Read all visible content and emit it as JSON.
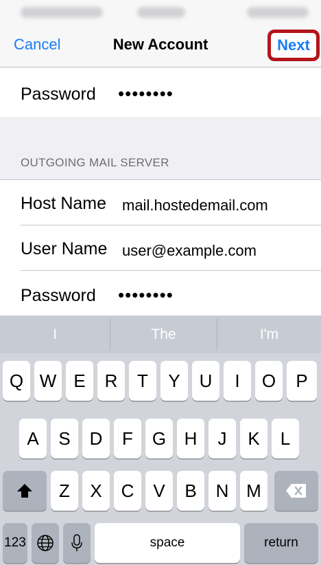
{
  "nav": {
    "cancel_label": "Cancel",
    "title": "New Account",
    "next_label": "Next"
  },
  "incoming": {
    "password_label": "Password",
    "password_value": "••••••••"
  },
  "outgoing": {
    "header": "OUTGOING MAIL SERVER",
    "host_label": "Host Name",
    "host_value": "mail.hostedemail.com",
    "user_label": "User Name",
    "user_value": "user@example.com",
    "password_label": "Password",
    "password_value": "••••••••"
  },
  "keyboard": {
    "suggestions": [
      "I",
      "The",
      "I'm"
    ],
    "row1": [
      "Q",
      "W",
      "E",
      "R",
      "T",
      "Y",
      "U",
      "I",
      "O",
      "P"
    ],
    "row2": [
      "A",
      "S",
      "D",
      "F",
      "G",
      "H",
      "J",
      "K",
      "L"
    ],
    "row3": [
      "Z",
      "X",
      "C",
      "V",
      "B",
      "N",
      "M"
    ],
    "numbers_label": "123",
    "space_label": "space",
    "return_label": "return"
  }
}
